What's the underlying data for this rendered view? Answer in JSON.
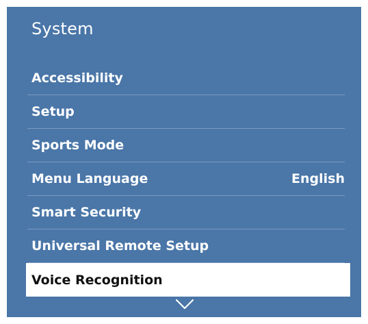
{
  "menu": {
    "title": "System",
    "items": [
      {
        "label": "Accessibility",
        "value": ""
      },
      {
        "label": "Setup",
        "value": ""
      },
      {
        "label": "Sports Mode",
        "value": ""
      },
      {
        "label": "Menu Language",
        "value": "English"
      },
      {
        "label": "Smart Security",
        "value": ""
      },
      {
        "label": "Universal Remote Setup",
        "value": ""
      },
      {
        "label": "Voice Recognition",
        "value": ""
      }
    ],
    "selected_index": 6,
    "scroll_icon": "chevron-down-icon"
  },
  "colors": {
    "panel_bg": "#4a76a8",
    "text": "#ffffff",
    "selected_bg": "#ffffff",
    "selected_text": "#111111"
  }
}
